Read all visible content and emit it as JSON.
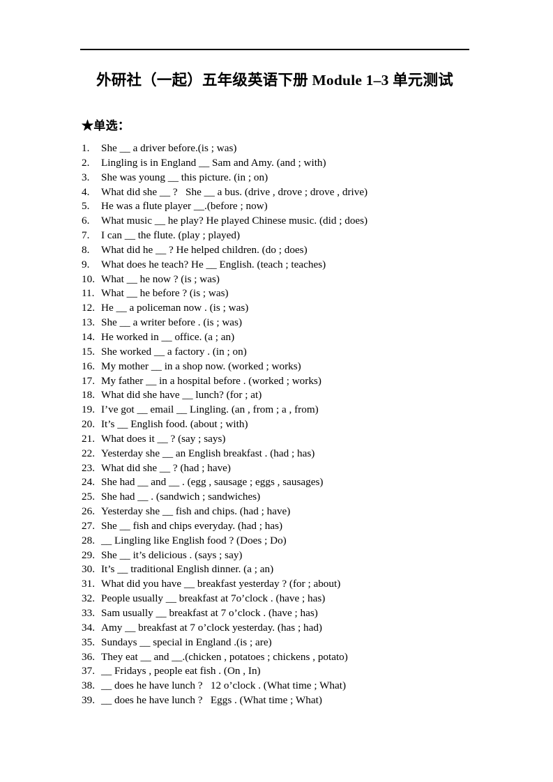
{
  "document": {
    "title": "外研社（一起）五年级英语下册 Module 1–3 单元测试",
    "section_header": "★单选："
  },
  "questions": [
    {
      "number": "1.",
      "text": "She __ a driver before.(is ; was)"
    },
    {
      "number": "2.",
      "text": "Lingling is in England __ Sam and Amy. (and ; with)"
    },
    {
      "number": "3.",
      "text": "She was young __ this picture. (in ; on)"
    },
    {
      "number": "4.",
      "text": "What did she __ ?   She __ a bus. (drive , drove ; drove , drive)"
    },
    {
      "number": "5.",
      "text": "He was a flute player __.(before ; now)"
    },
    {
      "number": "6.",
      "text": "What music __ he play? He played Chinese music. (did ; does)"
    },
    {
      "number": "7.",
      "text": "I can __ the flute. (play ; played)"
    },
    {
      "number": "8.",
      "text": "What did he __ ? He helped children. (do ; does)"
    },
    {
      "number": "9.",
      "text": "What does he teach? He __ English. (teach ; teaches)"
    },
    {
      "number": "10.",
      "text": "What __ he now ? (is ; was)"
    },
    {
      "number": "11.",
      "text": "What __ he before ? (is ; was)"
    },
    {
      "number": "12.",
      "text": "He __ a policeman now . (is ; was)"
    },
    {
      "number": "13.",
      "text": "She __ a writer before . (is ; was)"
    },
    {
      "number": "14.",
      "text": "He worked in __ office. (a ; an)"
    },
    {
      "number": "15.",
      "text": "She worked __ a factory . (in ; on)"
    },
    {
      "number": "16.",
      "text": "My mother __ in a shop now. (worked ; works)"
    },
    {
      "number": "17.",
      "text": "My father __ in a hospital before . (worked ; works)"
    },
    {
      "number": "18.",
      "text": "What did she have __ lunch? (for ; at)"
    },
    {
      "number": "19.",
      "text": "I’ve got __ email __ Lingling. (an , from ; a , from)"
    },
    {
      "number": "20.",
      "text": "It’s __ English food. (about ; with)"
    },
    {
      "number": "21.",
      "text": "What does it __ ? (say ; says)"
    },
    {
      "number": "22.",
      "text": "Yesterday she __ an English breakfast . (had ; has)"
    },
    {
      "number": "23.",
      "text": "What did she __ ? (had ; have)"
    },
    {
      "number": "24.",
      "text": "She had __ and __ . (egg , sausage ; eggs , sausages)"
    },
    {
      "number": "25.",
      "text": "She had __ . (sandwich ; sandwiches)"
    },
    {
      "number": "26.",
      "text": "Yesterday she __ fish and chips. (had ; have)"
    },
    {
      "number": "27.",
      "text": "She __ fish and chips everyday. (had ; has)"
    },
    {
      "number": "28.",
      "text": "__ Lingling like English food ? (Does ; Do)"
    },
    {
      "number": "29.",
      "text": "She __ it’s delicious . (says ; say)"
    },
    {
      "number": "30.",
      "text": "It’s __ traditional English dinner. (a ; an)"
    },
    {
      "number": "31.",
      "text": "What did you have __ breakfast yesterday ? (for ; about)"
    },
    {
      "number": "32.",
      "text": "People usually __ breakfast at 7o’clock . (have ; has)"
    },
    {
      "number": "33.",
      "text": "Sam usually __ breakfast at 7 o’clock . (have ; has)"
    },
    {
      "number": "34.",
      "text": "Amy __ breakfast at 7 o’clock yesterday. (has ; had)"
    },
    {
      "number": "35.",
      "text": "Sundays __ special in England .(is ; are)"
    },
    {
      "number": "36.",
      "text": "They eat __ and __.(chicken , potatoes ; chickens , potato)"
    },
    {
      "number": "37.",
      "text": "__ Fridays , people eat fish . (On , In)"
    },
    {
      "number": "38.",
      "text": "__ does he have lunch ?   12 o’clock . (What time ; What)"
    },
    {
      "number": "39.",
      "text": "__ does he have lunch ?   Eggs . (What time ; What)"
    }
  ]
}
